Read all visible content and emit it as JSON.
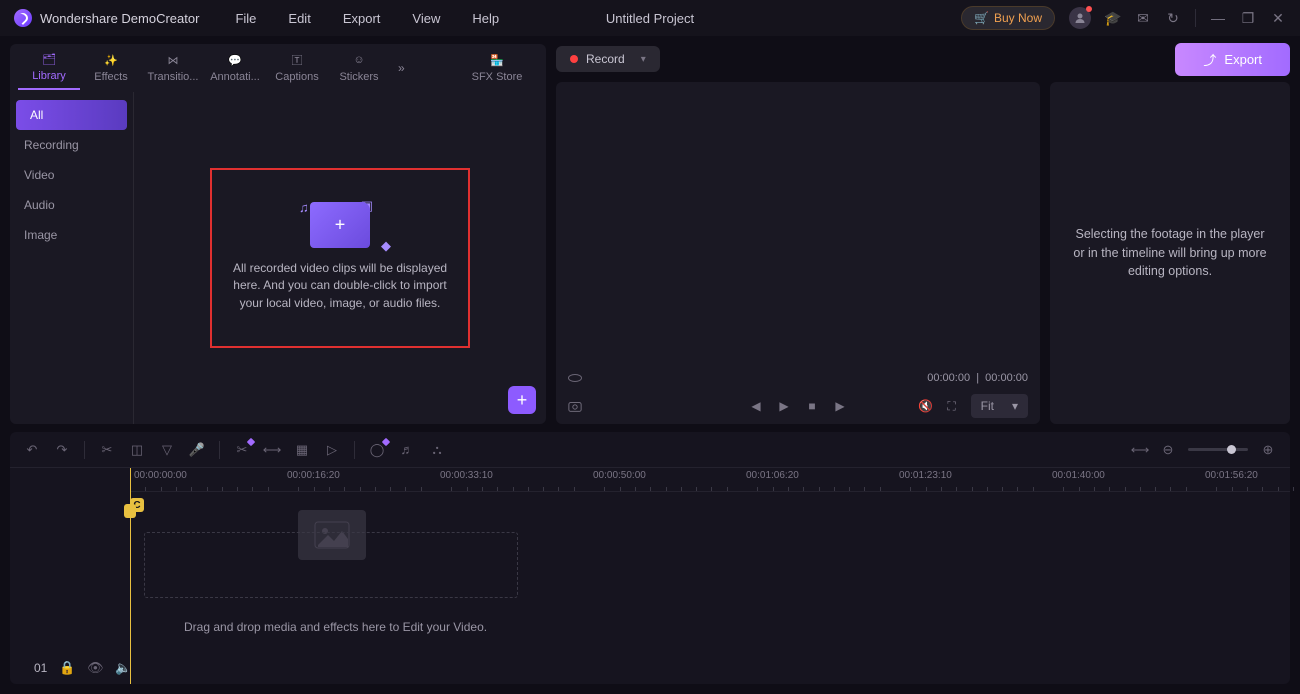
{
  "app_name": "Wondershare DemoCreator",
  "menubar": {
    "file": "File",
    "edit": "Edit",
    "export": "Export",
    "view": "View",
    "help": "Help"
  },
  "project_title": "Untitled Project",
  "buy_now": "Buy Now",
  "tabs": {
    "library": "Library",
    "effects": "Effects",
    "transitions": "Transitio...",
    "annotations": "Annotati...",
    "captions": "Captions",
    "stickers": "Stickers",
    "sfx": "SFX Store"
  },
  "sidebar": {
    "all": "All",
    "recording": "Recording",
    "video": "Video",
    "audio": "Audio",
    "image": "Image"
  },
  "import_hint": "All recorded video clips will be displayed here. And you can double-click to import your local video, image, or audio files.",
  "record_label": "Record",
  "export_label": "Export",
  "time": {
    "current": "00:00:00",
    "total": "00:00:00"
  },
  "fit_label": "Fit",
  "props_hint": "Selecting the footage in the player or in the timeline will bring up more editing options.",
  "ruler": [
    "00:00:00:00",
    "00:00:16:20",
    "00:00:33:10",
    "00:00:50:00",
    "00:01:06:20",
    "00:01:23:10",
    "00:01:40:00",
    "00:01:56:20"
  ],
  "drop_hint": "Drag and drop media and effects here to Edit your Video.",
  "track_num": "01",
  "cursor_badge": "C"
}
